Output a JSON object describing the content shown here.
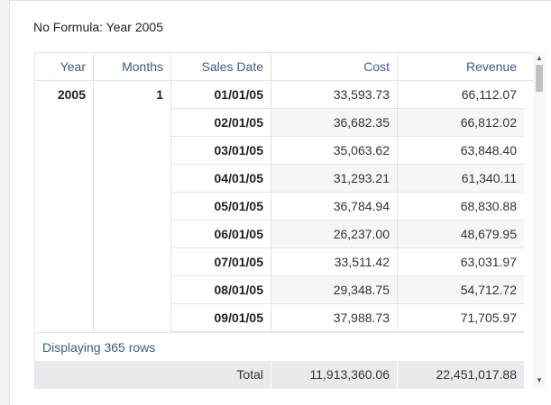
{
  "title": "No Formula: Year 2005",
  "columns": {
    "year": "Year",
    "months": "Months",
    "sales_date": "Sales Date",
    "cost": "Cost",
    "revenue": "Revenue"
  },
  "group": {
    "year": "2005",
    "month": "1"
  },
  "rows": [
    {
      "date": "01/01/05",
      "cost": "33,593.73",
      "revenue": "66,112.07"
    },
    {
      "date": "02/01/05",
      "cost": "36,682.35",
      "revenue": "66,812.02"
    },
    {
      "date": "03/01/05",
      "cost": "35,063.62",
      "revenue": "63,848.40"
    },
    {
      "date": "04/01/05",
      "cost": "31,293.21",
      "revenue": "61,340.11"
    },
    {
      "date": "05/01/05",
      "cost": "36,784.94",
      "revenue": "68,830.88"
    },
    {
      "date": "06/01/05",
      "cost": "26,237.00",
      "revenue": "48,679.95"
    },
    {
      "date": "07/01/05",
      "cost": "33,511.42",
      "revenue": "63,031.97"
    },
    {
      "date": "08/01/05",
      "cost": "29,348.75",
      "revenue": "54,712.72"
    },
    {
      "date": "09/01/05",
      "cost": "37,988.73",
      "revenue": "71,705.97"
    }
  ],
  "status": "Displaying 365 rows",
  "totals": {
    "label": "Total",
    "cost": "11,913,360.06",
    "revenue": "22,451,017.88"
  },
  "scrollbar": {
    "up_glyph": "▲",
    "down_glyph": "▼"
  }
}
